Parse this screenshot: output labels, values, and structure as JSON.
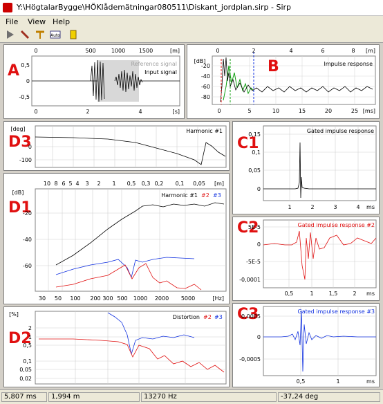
{
  "window": {
    "title": "Y:\\HögtalarBygge\\HÖKlådemätningar080511\\Diskant_jordplan.sirp - Sirp"
  },
  "menu": [
    "File",
    "View",
    "Help"
  ],
  "toolbar": {
    "icons": [
      "play-icon",
      "pen-icon",
      "marker-icon",
      "auto-icon",
      "battery-icon"
    ],
    "auto_label": "Auto"
  },
  "panels": {
    "A": {
      "label": "A",
      "legend": [
        "Reference signal",
        "Input signal"
      ],
      "top_unit": "[m]",
      "bottom_unit": "[s]",
      "top_ticks": [
        "0",
        "500",
        "1000",
        "1500"
      ],
      "bottom_ticks": [
        "0",
        "2",
        "4"
      ],
      "y_ticks": [
        "0,5",
        "0",
        "-0,5"
      ]
    },
    "B": {
      "label": "B",
      "legend": "Impulse response",
      "y_unit": "[dB]",
      "top_unit": "[m]",
      "bottom_unit": "[ms]",
      "top_ticks": [
        "0",
        "2",
        "4",
        "6",
        "8"
      ],
      "bottom_ticks": [
        "0",
        "5",
        "10",
        "15",
        "20",
        "25"
      ],
      "y_ticks": [
        "-20",
        "-40",
        "-60",
        "-80"
      ]
    },
    "D3": {
      "label": "D3",
      "y_unit": "[deg]",
      "legend": "Harmonic #1",
      "y_ticks": [
        "0",
        "-100"
      ]
    },
    "D1": {
      "label": "D1",
      "y_unit": "[dB]",
      "top_unit": "[m]",
      "bottom_unit": "[Hz]",
      "legend": {
        "main": "Harmonic #1",
        "h2": "#2",
        "h3": "#3"
      },
      "top_ticks": [
        "10",
        "8",
        "6",
        "5",
        "4",
        "3",
        "2",
        "1",
        "0,5",
        "0,3",
        "0,2",
        "0,1",
        "0,05"
      ],
      "bottom_ticks": [
        "30",
        "50",
        "100",
        "200",
        "300",
        "500",
        "1000",
        "2000",
        "5000"
      ],
      "y_ticks": [
        "-20",
        "-40",
        "-60"
      ]
    },
    "D2": {
      "label": "D2",
      "y_unit": "[%]",
      "legend": {
        "main": "Distortion",
        "h2": "#2",
        "h3": "#3"
      },
      "y_ticks": [
        "2",
        "1",
        "0,5",
        "0,1",
        "0,05",
        "0,02"
      ]
    },
    "C1": {
      "label": "C1",
      "legend": "Gated impulse response",
      "bottom_unit": "ms",
      "y_ticks": [
        "0,15",
        "0,1",
        "0,05",
        "0"
      ],
      "x_ticks": [
        "1",
        "2",
        "3",
        "4"
      ]
    },
    "C2": {
      "label": "C2",
      "legend": "Gated impulse response #2",
      "bottom_unit": "ms",
      "y_ticks": [
        "5E-5",
        "0",
        "-5E-5",
        "-0,0001"
      ],
      "x_ticks": [
        "0,5",
        "1",
        "1,5",
        "2"
      ]
    },
    "C3": {
      "label": "C3",
      "legend": "Gated impulse response #3",
      "bottom_unit": "ms",
      "y_ticks": [
        "0,0005",
        "0",
        "-0,0005"
      ],
      "x_ticks": [
        "0,5",
        "1"
      ]
    }
  },
  "status": [
    "5,807 ms",
    "1,994 m",
    "13270 Hz",
    "-37,24 deg"
  ],
  "colors": {
    "label": "#e01010",
    "h2": "#e01010",
    "h3": "#1030e0",
    "green": "#10a010"
  }
}
